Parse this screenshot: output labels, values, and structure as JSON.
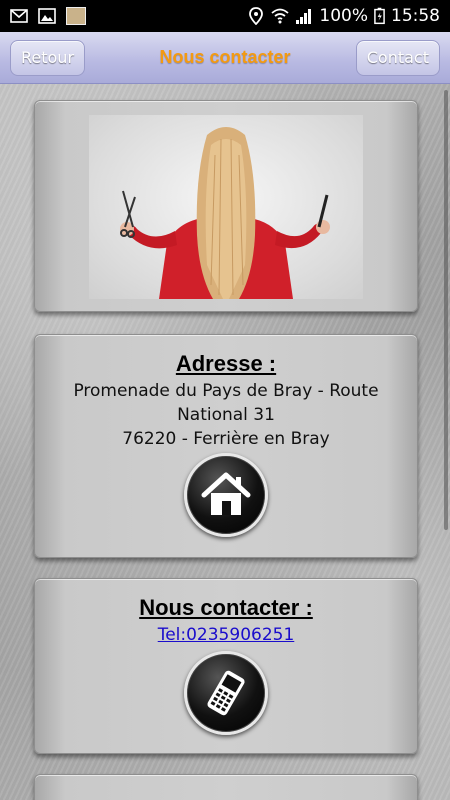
{
  "status_bar": {
    "battery": "100%",
    "time": "15:58",
    "icons": [
      "gmail-icon",
      "gallery-icon",
      "thumbnail-icon",
      "location-icon",
      "wifi-icon",
      "signal-icon",
      "battery-icon"
    ]
  },
  "nav": {
    "back_label": "Retour",
    "title": "Nous contacter",
    "contact_label": "Contact",
    "title_color": "#f39a12"
  },
  "address_card": {
    "heading": "Adresse :",
    "lines": [
      "Promenade du Pays de Bray - Route",
      "National 31",
      "76220 - Ferrière en Bray"
    ],
    "icon": "home-icon"
  },
  "contact_card": {
    "heading": "Nous contacter :",
    "tel": "Tel:0235906251",
    "icon": "mobile-phone-icon"
  }
}
